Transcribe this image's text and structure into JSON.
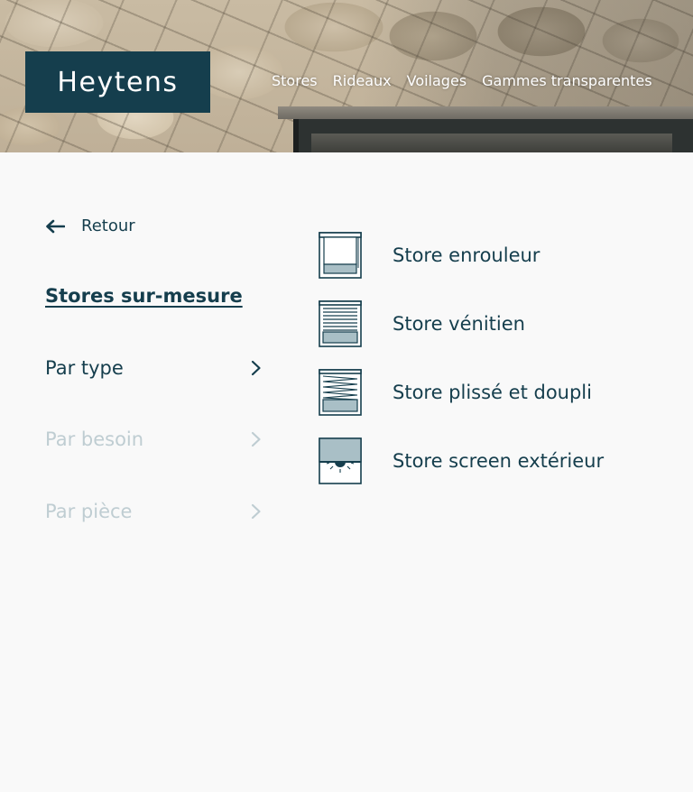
{
  "header": {
    "logo_text": "Heytens",
    "nav": [
      "Stores",
      "Rideaux",
      "Voilages",
      "Gammes transparentes"
    ]
  },
  "sidebar": {
    "back_label": "Retour",
    "title": "Stores sur-mesure",
    "items": [
      {
        "label": "Par type",
        "active": true
      },
      {
        "label": "Par besoin",
        "active": false
      },
      {
        "label": "Par pièce",
        "active": false
      }
    ]
  },
  "products": [
    {
      "label": "Store enrouleur",
      "icon": "roller-blind-icon"
    },
    {
      "label": "Store vénitien",
      "icon": "venetian-blind-icon"
    },
    {
      "label": "Store plissé et doupli",
      "icon": "pleated-blind-icon"
    },
    {
      "label": "Store screen extérieur",
      "icon": "exterior-screen-icon"
    }
  ],
  "colors": {
    "brand": "#153e4d",
    "inactive": "#bfcdd2",
    "background": "#f9f9f9",
    "icon_fill": "#a9bfc6"
  }
}
